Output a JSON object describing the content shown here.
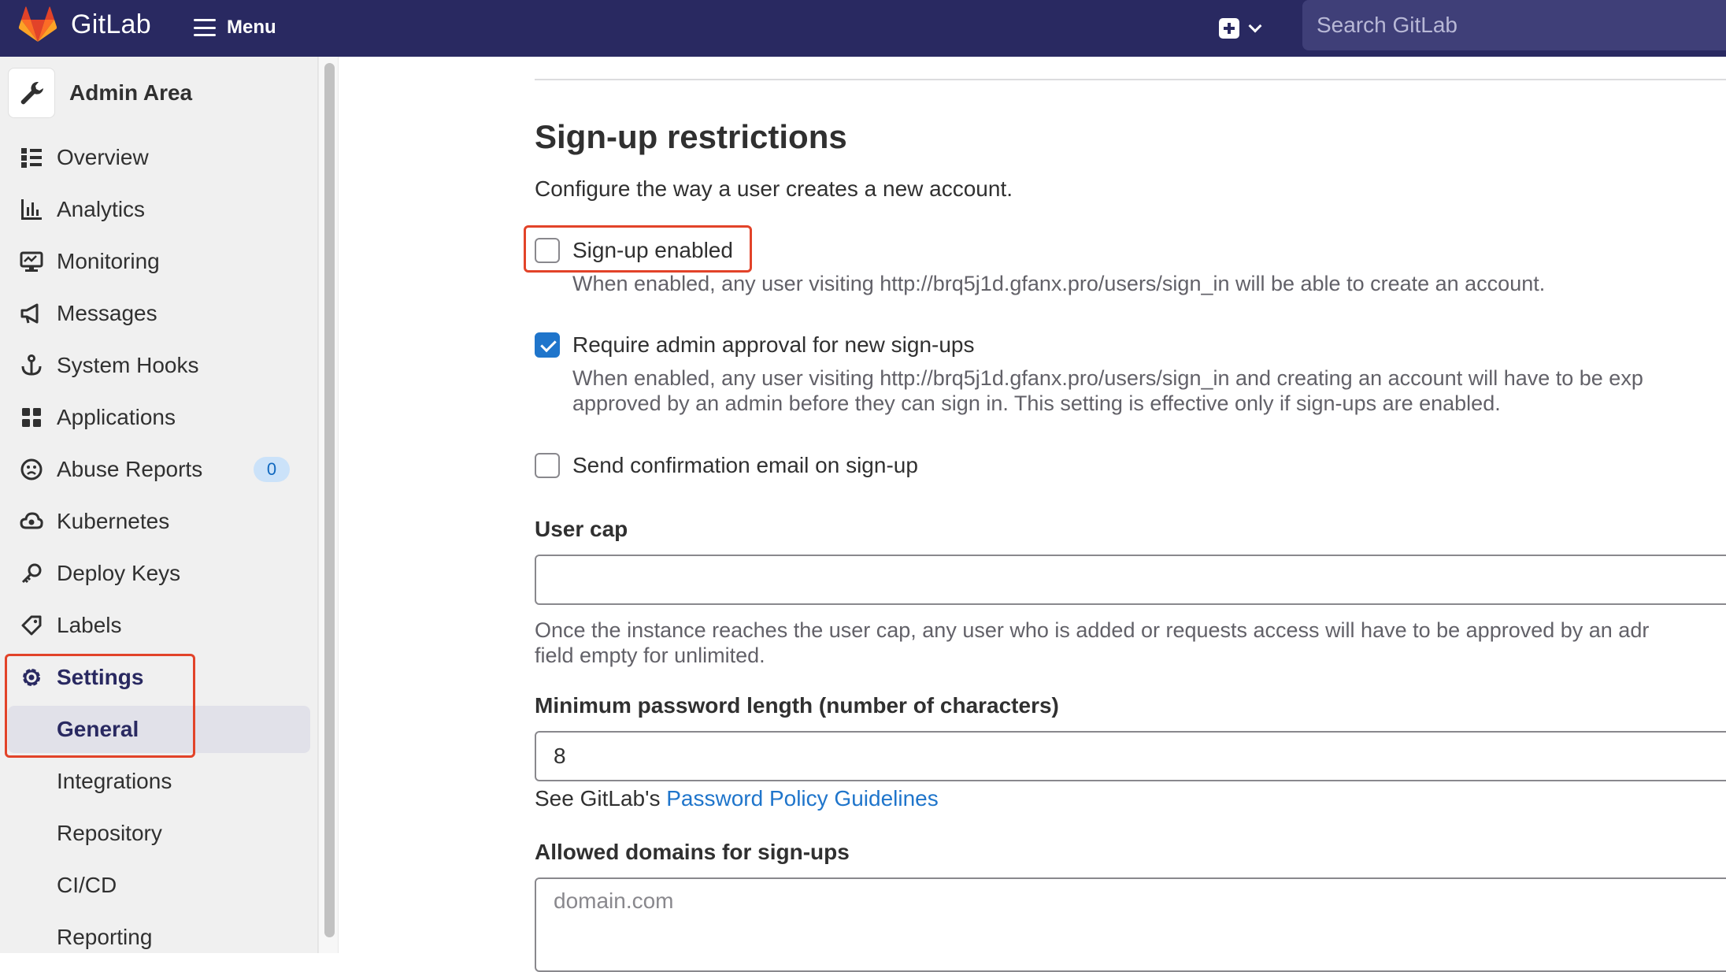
{
  "header": {
    "brand": "GitLab",
    "menu_label": "Menu",
    "search_placeholder": "Search GitLab"
  },
  "sidebar": {
    "context_title": "Admin Area",
    "items": [
      {
        "label": "Overview",
        "icon": "overview-icon"
      },
      {
        "label": "Analytics",
        "icon": "chart-icon"
      },
      {
        "label": "Monitoring",
        "icon": "monitor-icon"
      },
      {
        "label": "Messages",
        "icon": "megaphone-icon"
      },
      {
        "label": "System Hooks",
        "icon": "hook-icon"
      },
      {
        "label": "Applications",
        "icon": "applications-icon"
      },
      {
        "label": "Abuse Reports",
        "icon": "sad-face-icon",
        "badge": "0"
      },
      {
        "label": "Kubernetes",
        "icon": "kubernetes-cloud-icon"
      },
      {
        "label": "Deploy Keys",
        "icon": "key-icon"
      },
      {
        "label": "Labels",
        "icon": "label-icon"
      },
      {
        "label": "Settings",
        "icon": "gear-icon",
        "active": true
      }
    ],
    "sub_items": [
      {
        "label": "General",
        "active": true
      },
      {
        "label": "Integrations"
      },
      {
        "label": "Repository"
      },
      {
        "label": "CI/CD"
      },
      {
        "label": "Reporting"
      }
    ]
  },
  "main": {
    "title": "Sign-up restrictions",
    "description": "Configure the way a user creates a new account.",
    "signup_enabled": {
      "label": "Sign-up enabled",
      "checked": false,
      "help": "When enabled, any user visiting http://brq5j1d.gfanx.pro/users/sign_in will be able to create an account."
    },
    "admin_approval": {
      "label": "Require admin approval for new sign-ups",
      "checked": true,
      "help_line1": "When enabled, any user visiting http://brq5j1d.gfanx.pro/users/sign_in and creating an account will have to be exp",
      "help_line2": "approved by an admin before they can sign in. This setting is effective only if sign-ups are enabled."
    },
    "confirmation_email": {
      "label": "Send confirmation email on sign-up",
      "checked": false
    },
    "user_cap": {
      "label": "User cap",
      "value": "",
      "help_line1": "Once the instance reaches the user cap, any user who is added or requests access will have to be approved by an adr",
      "help_line2": "field empty for unlimited."
    },
    "min_password": {
      "label": "Minimum password length (number of characters)",
      "value": "8",
      "help_prefix": "See GitLab's ",
      "help_link": "Password Policy Guidelines"
    },
    "allowed_domains": {
      "label": "Allowed domains for sign-ups",
      "placeholder": "domain.com"
    }
  },
  "colors": {
    "header_bg": "#292961",
    "link": "#1f75cb",
    "highlight": "#e24329",
    "checkbox_checked": "#1f75cb"
  }
}
